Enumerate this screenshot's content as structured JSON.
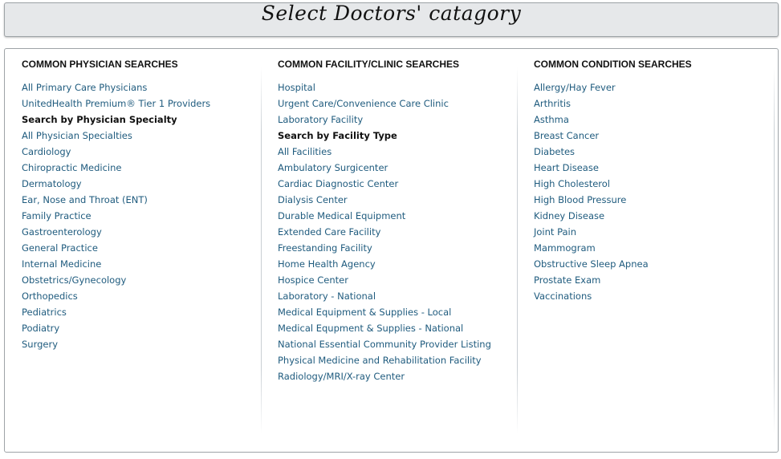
{
  "header": {
    "title": "Select Doctors' catagory"
  },
  "columns": [
    {
      "heading": "COMMON PHYSICIAN SEARCHES",
      "items": [
        {
          "label": "All Primary Care Physicians",
          "bold": false
        },
        {
          "label": "UnitedHealth Premium® Tier 1 Providers",
          "bold": false
        },
        {
          "label": "Search by Physician Specialty",
          "bold": true
        },
        {
          "label": "All Physician Specialties",
          "bold": false
        },
        {
          "label": "Cardiology",
          "bold": false
        },
        {
          "label": "Chiropractic Medicine",
          "bold": false
        },
        {
          "label": "Dermatology",
          "bold": false
        },
        {
          "label": "Ear, Nose and Throat (ENT)",
          "bold": false
        },
        {
          "label": "Family Practice",
          "bold": false
        },
        {
          "label": "Gastroenterology",
          "bold": false
        },
        {
          "label": "General Practice",
          "bold": false
        },
        {
          "label": "Internal Medicine",
          "bold": false
        },
        {
          "label": "Obstetrics/Gynecology",
          "bold": false
        },
        {
          "label": "Orthopedics",
          "bold": false
        },
        {
          "label": "Pediatrics",
          "bold": false
        },
        {
          "label": "Podiatry",
          "bold": false
        },
        {
          "label": "Surgery",
          "bold": false
        }
      ]
    },
    {
      "heading": "COMMON FACILITY/CLINIC SEARCHES",
      "items": [
        {
          "label": "Hospital",
          "bold": false
        },
        {
          "label": "Urgent Care/Convenience Care Clinic",
          "bold": false
        },
        {
          "label": "Laboratory Facility",
          "bold": false
        },
        {
          "label": "Search by Facility Type",
          "bold": true
        },
        {
          "label": "All Facilities",
          "bold": false
        },
        {
          "label": "Ambulatory Surgicenter",
          "bold": false
        },
        {
          "label": "Cardiac Diagnostic Center",
          "bold": false
        },
        {
          "label": "Dialysis Center",
          "bold": false
        },
        {
          "label": "Durable Medical Equipment",
          "bold": false
        },
        {
          "label": "Extended Care Facility",
          "bold": false
        },
        {
          "label": "Freestanding Facility",
          "bold": false
        },
        {
          "label": "Home Health Agency",
          "bold": false
        },
        {
          "label": "Hospice Center",
          "bold": false
        },
        {
          "label": "Laboratory - National",
          "bold": false
        },
        {
          "label": "Medical Equipment & Supplies - Local",
          "bold": false
        },
        {
          "label": "Medical Equpment & Supplies - National",
          "bold": false
        },
        {
          "label": "National Essential Community Provider Listing",
          "bold": false
        },
        {
          "label": "Physical Medicine and Rehabilitation Facility",
          "bold": false
        },
        {
          "label": "Radiology/MRI/X-ray Center",
          "bold": false
        }
      ]
    },
    {
      "heading": "COMMON CONDITION SEARCHES",
      "items": [
        {
          "label": "Allergy/Hay Fever",
          "bold": false
        },
        {
          "label": "Arthritis",
          "bold": false
        },
        {
          "label": "Asthma",
          "bold": false
        },
        {
          "label": "Breast Cancer",
          "bold": false
        },
        {
          "label": "Diabetes",
          "bold": false
        },
        {
          "label": "Heart Disease",
          "bold": false
        },
        {
          "label": "High Cholesterol",
          "bold": false
        },
        {
          "label": "High Blood Pressure",
          "bold": false
        },
        {
          "label": "Kidney Disease",
          "bold": false
        },
        {
          "label": "Joint Pain",
          "bold": false
        },
        {
          "label": "Mammogram",
          "bold": false
        },
        {
          "label": "Obstructive Sleep Apnea",
          "bold": false
        },
        {
          "label": "Prostate Exam",
          "bold": false
        },
        {
          "label": "Vaccinations",
          "bold": false
        }
      ]
    }
  ],
  "colors": {
    "link": "#1f5b7e",
    "heading": "#111111",
    "header_bg": "#e6e8ea",
    "border": "#9ea3a7"
  }
}
